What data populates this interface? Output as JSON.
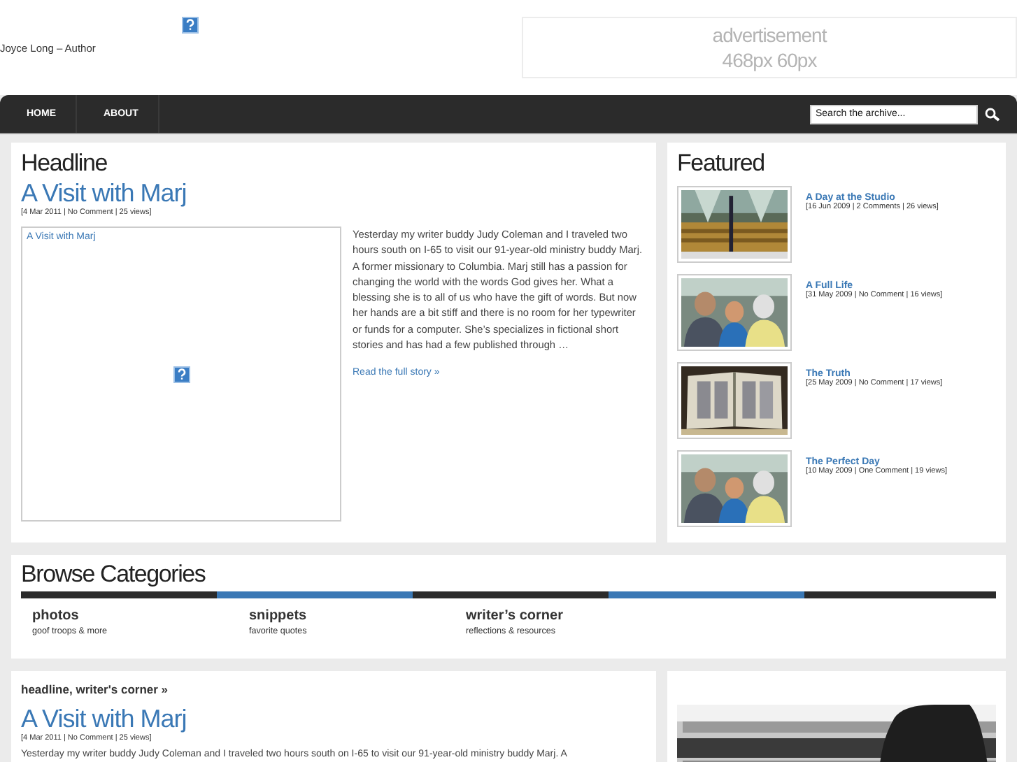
{
  "header": {
    "tagline": "Joyce Long – Author",
    "advertisement": [
      "advertisement",
      "468px 60px"
    ]
  },
  "nav": {
    "items": [
      {
        "label": "HOME"
      },
      {
        "label": "ABOUT"
      }
    ],
    "search": {
      "placeholder": "Search the archive..."
    }
  },
  "headline": {
    "section_title": "Headline",
    "title": "A Visit with Marj",
    "meta": "[4 Mar 2011 | No Comment | 25 views]",
    "image_alt": "A Visit with Marj",
    "excerpt": "Yesterday my writer buddy Judy Coleman and I traveled two hours south on I-65 to visit our 91-year-old ministry buddy Marj. A former missionary to Columbia. Marj still has a passion for changing the world with the words God gives her. What a blessing she is to all of us who have the gift of words. But now her hands are a bit stiff and there is no room for her typewriter or funds for a computer. She’s specializes in fictional short stories and has had a few published through …",
    "read_more": "Read the full story »"
  },
  "featured": {
    "section_title": "Featured",
    "items": [
      {
        "title": "A Day at the Studio",
        "meta": "[16 Jun 2009 | 2 Comments | 26 views]",
        "kind": "hall"
      },
      {
        "title": "A Full Life",
        "meta": "[31 May 2009 | No Comment | 16 views]",
        "kind": "people"
      },
      {
        "title": "The Truth",
        "meta": "[25 May 2009 | No Comment | 17 views]",
        "kind": "book"
      },
      {
        "title": "The Perfect Day",
        "meta": "[10 May 2009 | One Comment | 19 views]",
        "kind": "people"
      }
    ]
  },
  "categories": {
    "section_title": "Browse Categories",
    "items": [
      {
        "name": "photos",
        "description": "goof troops & more"
      },
      {
        "name": "snippets",
        "description": "favorite quotes"
      },
      {
        "name": "writer’s corner",
        "description": "reflections & resources"
      }
    ]
  },
  "latest": {
    "breadcrumb": "headline, writer's corner »",
    "title": "A Visit with Marj",
    "meta": "[4 Mar 2011 | No Comment | 25 views]",
    "excerpt": "Yesterday my writer buddy Judy Coleman and I traveled two hours south on I-65 to visit our 91-year-old ministry buddy Marj. A"
  }
}
